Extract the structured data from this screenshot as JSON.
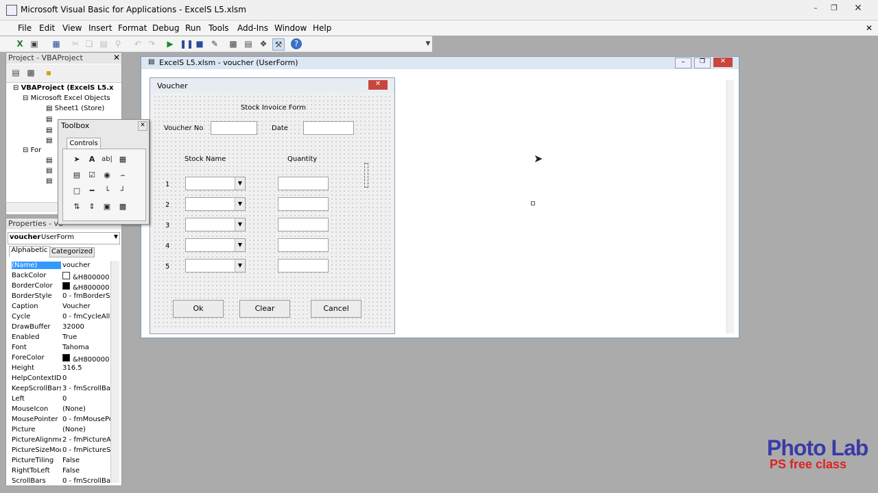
{
  "window": {
    "title": "Microsoft Visual Basic for Applications - ExcelS L5.xlsm"
  },
  "menu": [
    "File",
    "Edit",
    "View",
    "Insert",
    "Format",
    "Debug",
    "Run",
    "Tools",
    "Add-Ins",
    "Window",
    "Help"
  ],
  "project": {
    "title": "Project - VBAProject",
    "tree": [
      "VBAProject (ExcelS L5.x",
      "Microsoft Excel Objects",
      "Sheet1 (Store)",
      "For"
    ]
  },
  "toolbox": {
    "title": "Toolbox",
    "tab": "Controls"
  },
  "properties": {
    "title": "Properties - vo",
    "object": "voucher",
    "object_type": "UserForm",
    "tabs": [
      "Alphabetic",
      "Categorized"
    ],
    "rows": [
      {
        "k": "(Name)",
        "v": "voucher"
      },
      {
        "k": "BackColor",
        "v": "&H800000"
      },
      {
        "k": "BorderColor",
        "v": "&H800000"
      },
      {
        "k": "BorderStyle",
        "v": "0 - fmBorderSt"
      },
      {
        "k": "Caption",
        "v": "Voucher"
      },
      {
        "k": "Cycle",
        "v": "0 - fmCycleAllF"
      },
      {
        "k": "DrawBuffer",
        "v": "32000"
      },
      {
        "k": "Enabled",
        "v": "True"
      },
      {
        "k": "Font",
        "v": "Tahoma"
      },
      {
        "k": "ForeColor",
        "v": "&H800000"
      },
      {
        "k": "Height",
        "v": "316.5"
      },
      {
        "k": "HelpContextID",
        "v": "0"
      },
      {
        "k": "KeepScrollBarsV",
        "v": "3 - fmScrollBar"
      },
      {
        "k": "Left",
        "v": "0"
      },
      {
        "k": "MouseIcon",
        "v": "(None)"
      },
      {
        "k": "MousePointer",
        "v": "0 - fmMousePo"
      },
      {
        "k": "Picture",
        "v": "(None)"
      },
      {
        "k": "PictureAlignmen",
        "v": "2 - fmPictureAl"
      },
      {
        "k": "PictureSizeMode",
        "v": "0 - fmPictureSi"
      },
      {
        "k": "PictureTiling",
        "v": "False"
      },
      {
        "k": "RightToLeft",
        "v": "False"
      },
      {
        "k": "ScrollBars",
        "v": "0 - fmScrollBar"
      }
    ]
  },
  "child_window": {
    "title": "ExcelS L5.xlsm - voucher (UserForm)"
  },
  "userform": {
    "caption": "Voucher",
    "heading": "Stock Invoice Form",
    "voucher_label": "Voucher No",
    "date_label": "Date",
    "stock_header": "Stock Name",
    "qty_header": "Quantity",
    "rows": [
      "1",
      "2",
      "3",
      "4",
      "5"
    ],
    "ok": "Ok",
    "clear": "Clear",
    "cancel": "Cancel"
  },
  "watermark": {
    "line1": "Photo Lab",
    "line2": "PS free class"
  },
  "colors": {
    "selected": "#3399ff",
    "titlebar": "#f0f0f0"
  }
}
